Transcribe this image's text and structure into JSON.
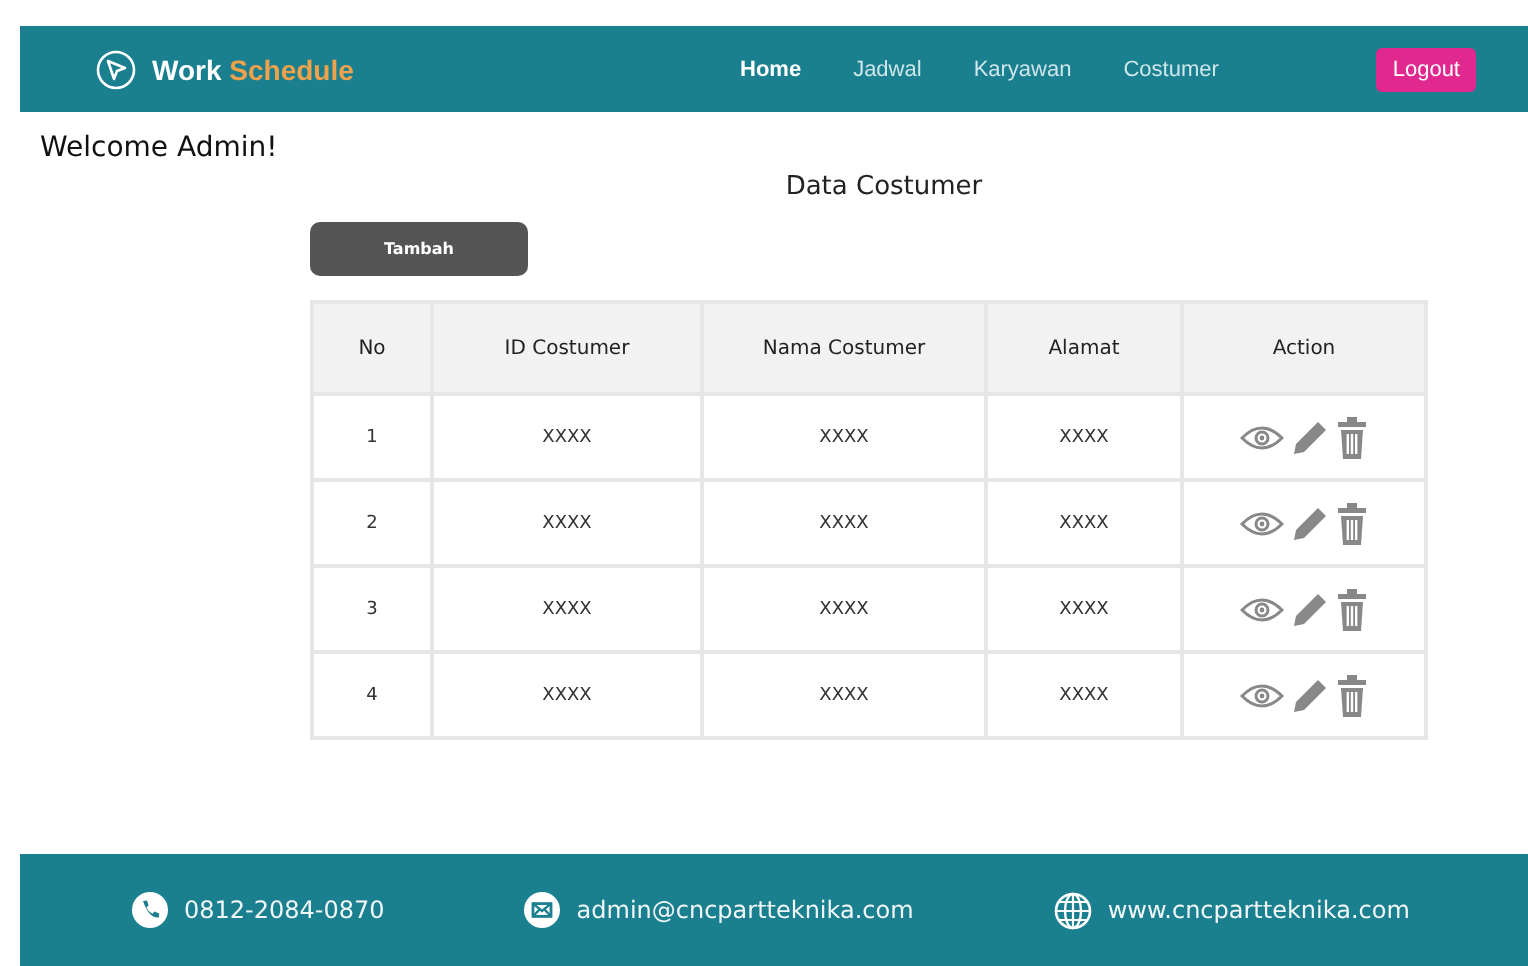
{
  "brand": {
    "first": "Work",
    "second": "Schedule"
  },
  "nav": [
    {
      "label": "Home",
      "selected": true
    },
    {
      "label": "Jadwal",
      "selected": false
    },
    {
      "label": "Karyawan",
      "selected": false
    },
    {
      "label": "Costumer",
      "selected": false
    }
  ],
  "logout": "Logout",
  "welcome": "Welcome Admin!",
  "page_title": "Data Costumer",
  "add_button": "Tambah",
  "table": {
    "columns": [
      "No",
      "ID Costumer",
      "Nama Costumer",
      "Alamat",
      "Action"
    ],
    "rows": [
      [
        "1",
        "XXXX",
        "XXXX",
        "XXXX"
      ],
      [
        "2",
        "XXXX",
        "XXXX",
        "XXXX"
      ],
      [
        "3",
        "XXXX",
        "XXXX",
        "XXXX"
      ],
      [
        "4",
        "XXXX",
        "XXXX",
        "XXXX"
      ]
    ]
  },
  "footer": [
    {
      "kind": "phone",
      "text": "0812-2084-0870"
    },
    {
      "kind": "email",
      "text": "admin@cncpartteknika.com"
    },
    {
      "kind": "web",
      "text": "www.cncpartteknika.com"
    }
  ]
}
